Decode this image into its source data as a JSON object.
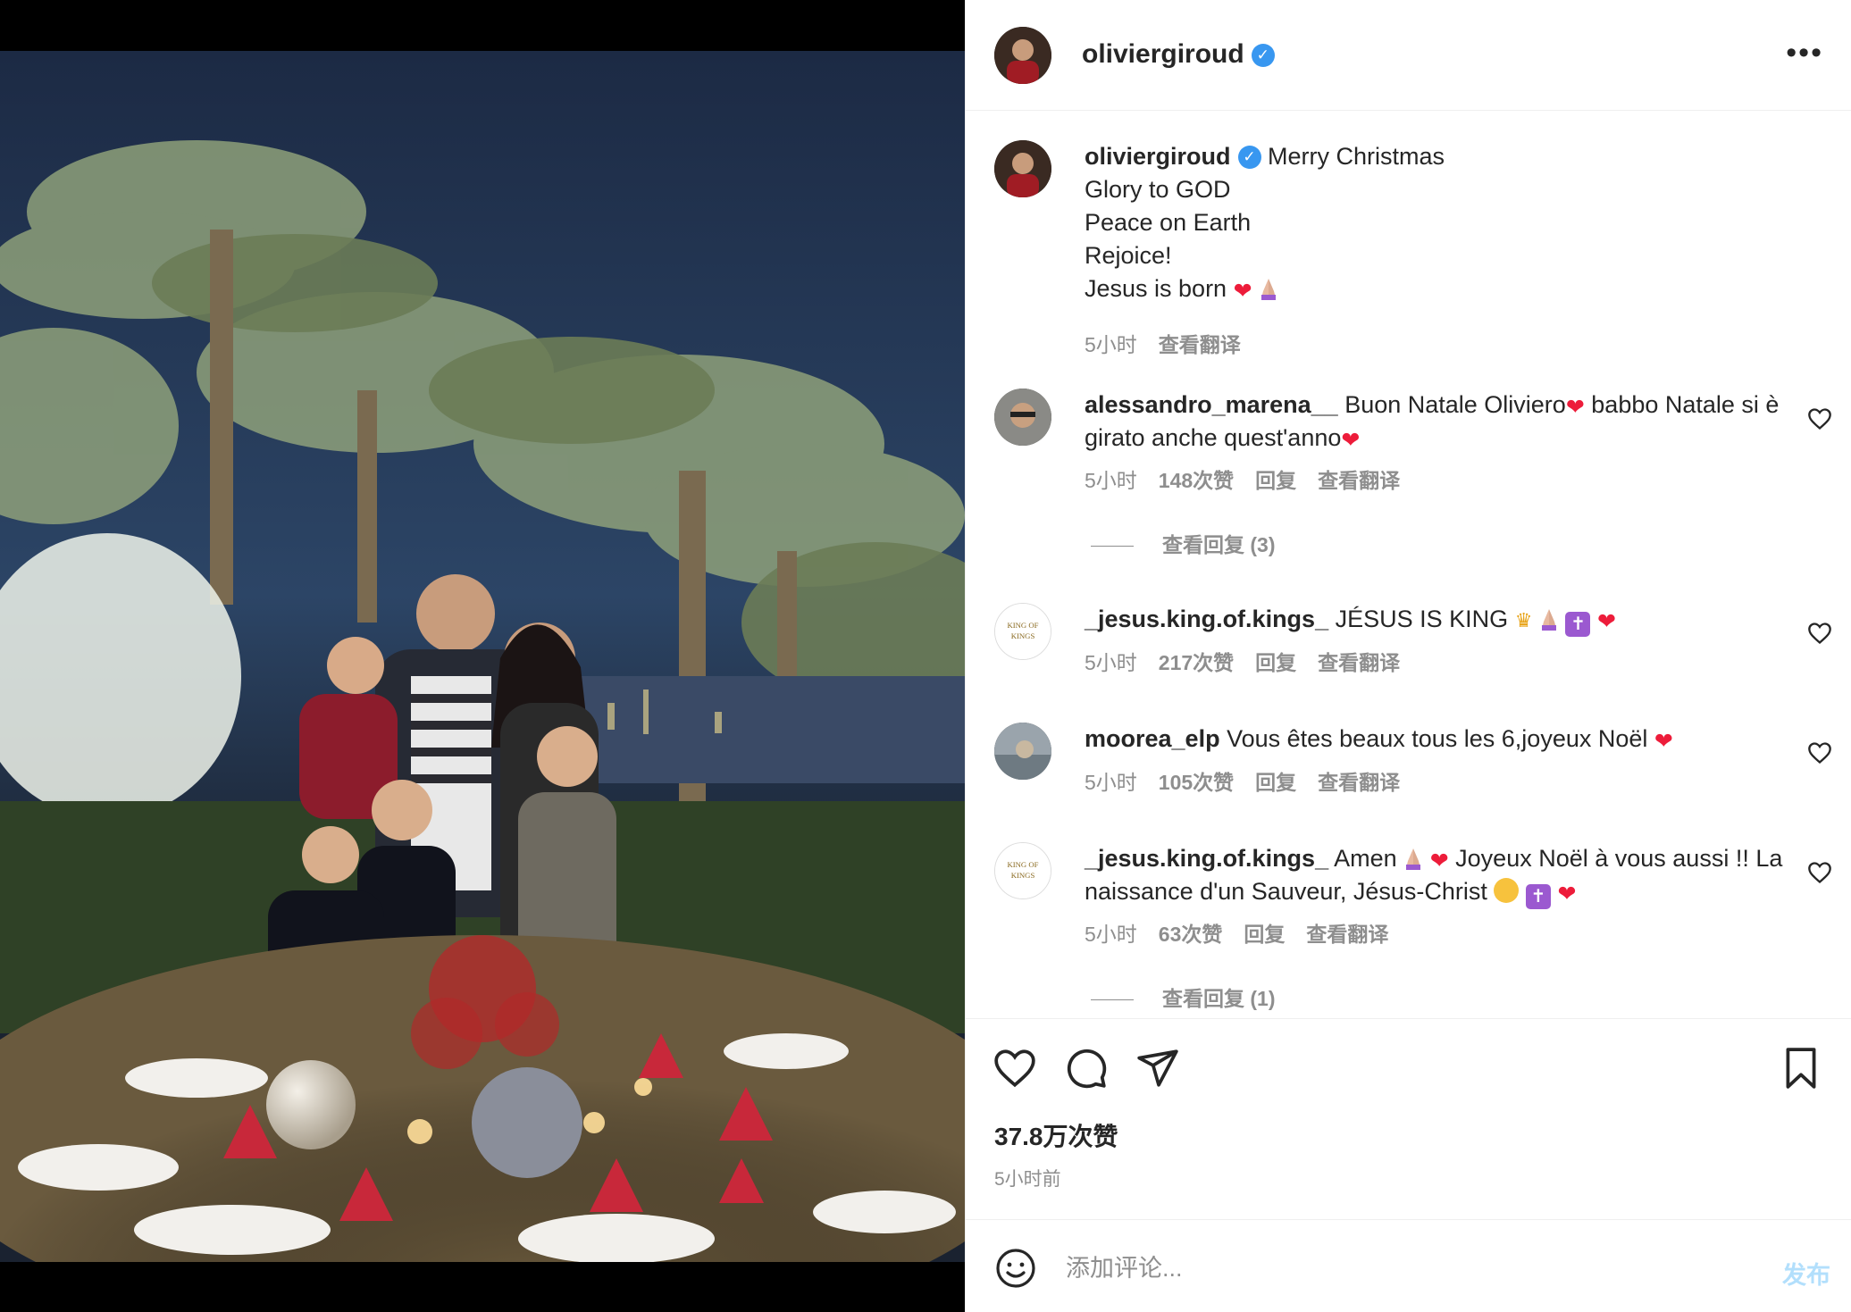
{
  "post": {
    "author": "oliviergiroud",
    "caption_lines": [
      "Merry Christmas",
      "Glory to GOD",
      "Peace on Earth",
      "Rejoice!",
      "Jesus is born"
    ],
    "caption_time": "5小时",
    "caption_translate": "查看翻译"
  },
  "comments": [
    {
      "user": "alessandro_marena__",
      "text_a": "Buon Natale Oliviero",
      "text_b": " babbo Natale si è girato anche quest'anno",
      "time": "5小时",
      "likes": "148次赞",
      "reply": "回复",
      "translate": "查看翻译",
      "view_replies": "查看回复 (3)"
    },
    {
      "user": "_jesus.king.of.kings_",
      "text": "JÉSUS IS KING",
      "time": "5小时",
      "likes": "217次赞",
      "reply": "回复",
      "translate": "查看翻译"
    },
    {
      "user": "moorea_elp",
      "text": "Vous êtes beaux tous les 6,joyeux Noël",
      "time": "5小时",
      "likes": "105次赞",
      "reply": "回复",
      "translate": "查看翻译"
    },
    {
      "user": "_jesus.king.of.kings_",
      "text_a": "Amen",
      "text_b": "Joyeux Noël à vous aussi !! La naissance d'un Sauveur, Jésus-Christ",
      "time": "5小时",
      "likes": "63次赞",
      "reply": "回复",
      "translate": "查看翻译",
      "view_replies": "查看回复 (1)"
    }
  ],
  "stats": {
    "likes": "37.8万次赞",
    "posted": "5小时前"
  },
  "composer": {
    "placeholder": "添加评论...",
    "post_label": "发布"
  },
  "icons": {
    "verified": "verified-badge-icon",
    "more": "more-options-icon",
    "like": "heart-icon",
    "comment": "comment-icon",
    "share": "share-icon",
    "save": "bookmark-icon",
    "emoji": "emoji-icon"
  },
  "colors": {
    "verified": "#3897f0",
    "heart": "#ed1c3a",
    "muted": "#8e8e8e",
    "post_button": "#b2dffc"
  }
}
